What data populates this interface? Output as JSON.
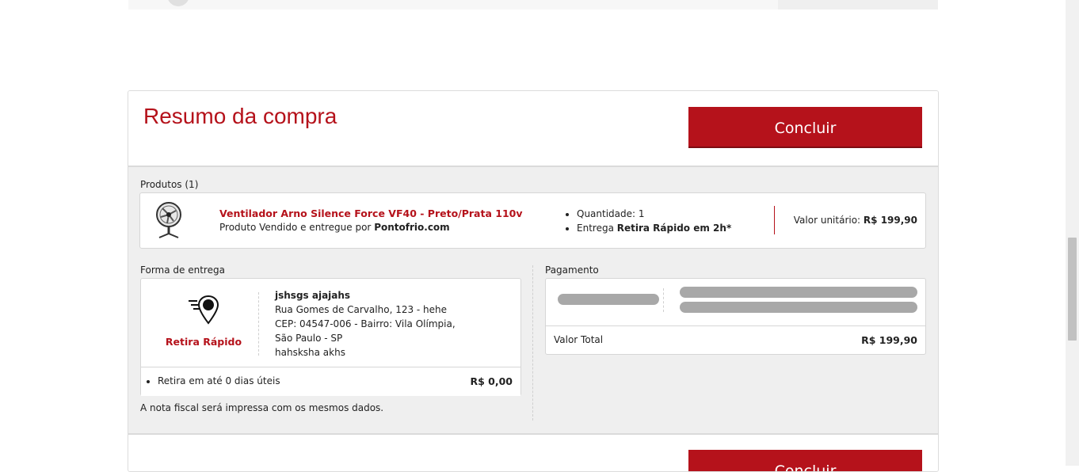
{
  "summary": {
    "title": "Resumo da compra",
    "conclude_label": "Concluir"
  },
  "products": {
    "label": "Produtos (1)",
    "items": [
      {
        "name": "Ventilador Arno Silence Force VF40 - Preto/Prata 110v",
        "seller_prefix": "Produto Vendido e entregue por",
        "seller": "Pontofrio.com",
        "quantity": "Quantidade: 1",
        "delivery_prefix": "Entrega",
        "delivery_mode": "Retira Rápido em 2h*",
        "unit_price_label": "Valor unitário:",
        "unit_price": "R$ 199,90",
        "icon": "fan-icon"
      }
    ]
  },
  "delivery": {
    "label": "Forma de entrega",
    "type": "Retira Rápido",
    "icon": "location-pin-icon",
    "address": {
      "name": "jshsgs ajajahs",
      "line1": "Rua Gomes de Carvalho, 123 - hehe",
      "line2": "CEP: 04547-006 - Bairro: Vila Olímpia,",
      "line3": "São Paulo - SP",
      "line4": "hahsksha akhs"
    },
    "deadline": "Retira em até 0 dias úteis",
    "cost": "R$ 0,00",
    "invoice_note": "A nota fiscal será impressa com os mesmos dados."
  },
  "payment": {
    "label": "Pagamento",
    "total_label": "Valor Total",
    "total_value": "R$ 199,90"
  },
  "colors": {
    "accent": "#b5121b",
    "panel_bg": "#efefef",
    "skeleton": "#a8a8a8"
  }
}
